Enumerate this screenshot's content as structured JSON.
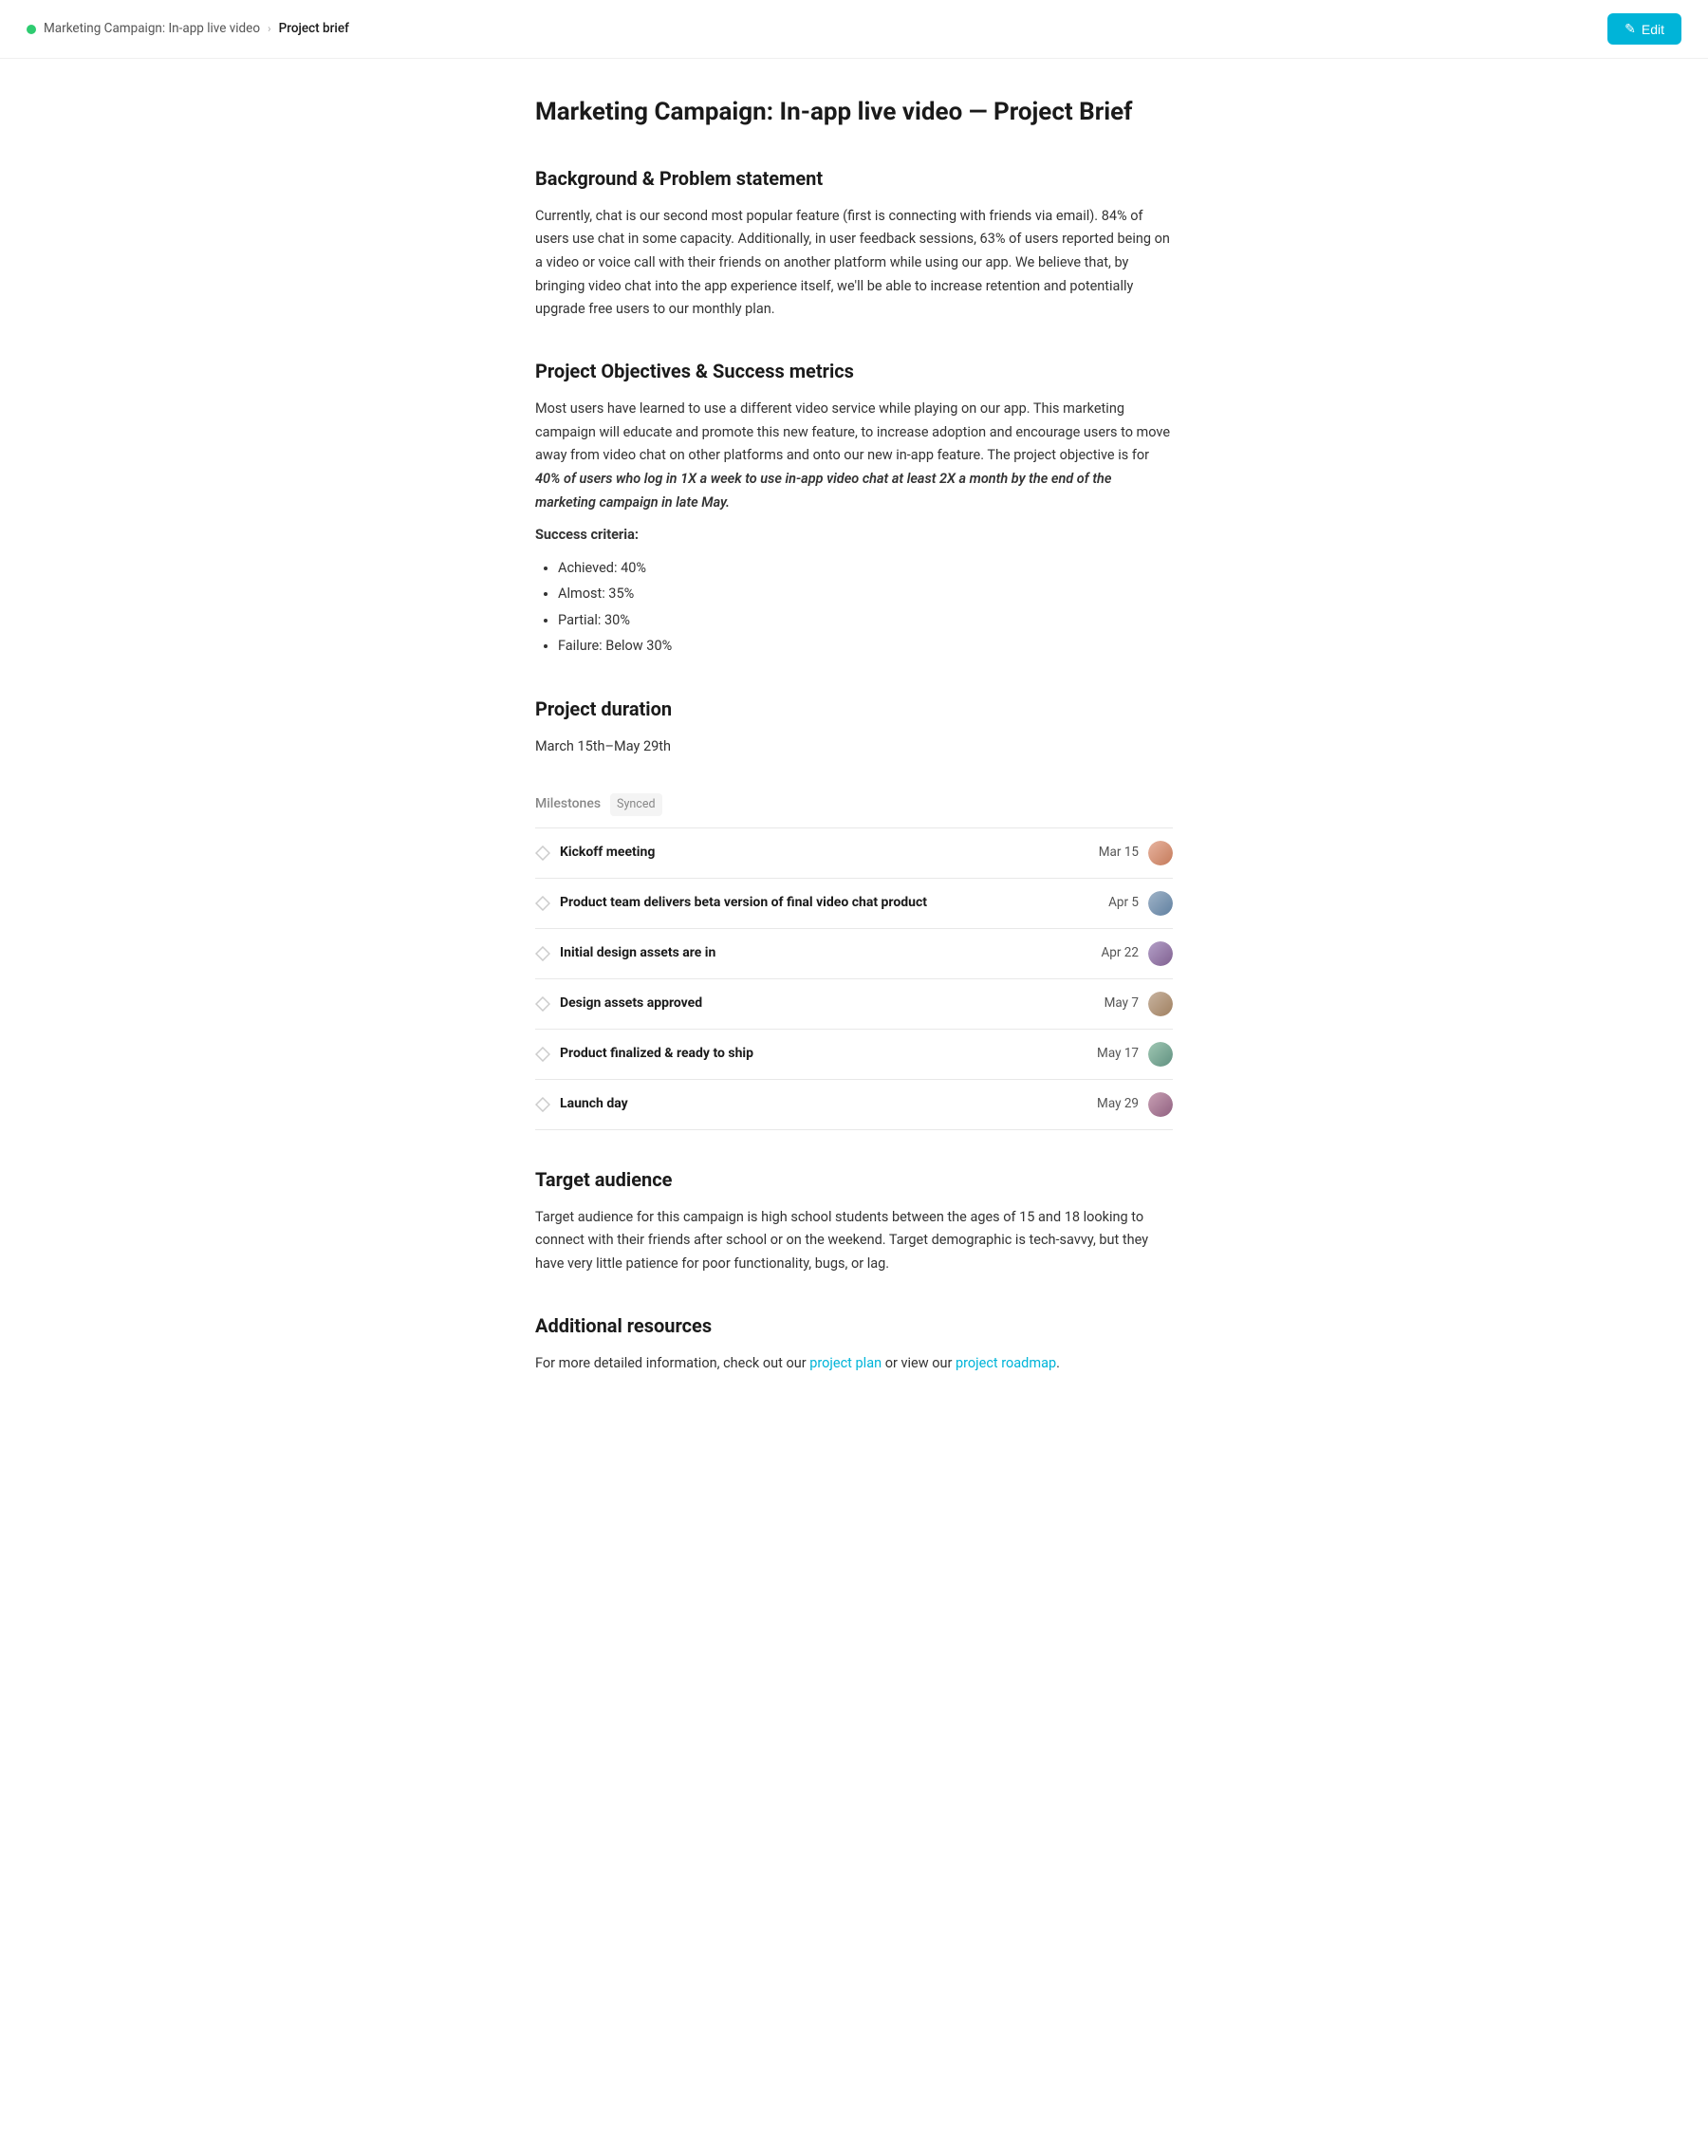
{
  "nav": {
    "dot_color": "#2ecc71",
    "parent_label": "Marketing Campaign: In-app live video",
    "chevron": "›",
    "current_label": "Project brief",
    "edit_button_label": "Edit",
    "edit_icon": "✎"
  },
  "page": {
    "title": "Marketing Campaign: In-app live video — Project Brief"
  },
  "sections": {
    "background": {
      "heading": "Background & Problem statement",
      "body": "Currently, chat is our second most popular feature (first is connecting with friends via email). 84% of users use chat in some capacity. Additionally, in user feedback sessions, 63% of users reported being on a video or voice call with their friends on another platform while using our app. We believe that, by bringing video chat into the app experience itself, we'll be able to increase retention and potentially upgrade free users to our monthly plan."
    },
    "objectives": {
      "heading": "Project Objectives & Success metrics",
      "body_prefix": "Most users have learned to use a different video service while playing on our app. This marketing campaign will educate and promote this new feature, to increase adoption and encourage users to move away from video chat on other platforms and onto our new in-app feature. The project objective is for ",
      "body_italic": "40% of users who log in 1X a week to use in-app video chat at least 2X a month by the end of the marketing campaign in late May.",
      "success_criteria_label": "Success criteria:",
      "criteria": [
        "Achieved: 40%",
        "Almost: 35%",
        "Partial: 30%",
        "Failure: Below 30%"
      ]
    },
    "duration": {
      "heading": "Project duration",
      "body": "March 15th–May 29th"
    },
    "milestones": {
      "label": "Milestones",
      "synced": "Synced",
      "items": [
        {
          "name": "Kickoff meeting",
          "date": "Mar 15",
          "avatar_class": "av1"
        },
        {
          "name": "Product team delivers beta version of final video chat product",
          "date": "Apr 5",
          "avatar_class": "av2"
        },
        {
          "name": "Initial design assets are in",
          "date": "Apr 22",
          "avatar_class": "av3"
        },
        {
          "name": "Design assets approved",
          "date": "May 7",
          "avatar_class": "av4"
        },
        {
          "name": "Product finalized & ready to ship",
          "date": "May 17",
          "avatar_class": "av5"
        },
        {
          "name": "Launch day",
          "date": "May 29",
          "avatar_class": "av6"
        }
      ]
    },
    "target_audience": {
      "heading": "Target audience",
      "body": "Target audience for this campaign is high school students between the ages of 15 and 18 looking to connect with their friends after school or on the weekend. Target demographic is tech-savvy, but they have very little patience for poor functionality, bugs, or lag."
    },
    "additional_resources": {
      "heading": "Additional resources",
      "body_prefix": "For more detailed information, check out our ",
      "link1_label": "project plan",
      "link1_href": "#",
      "body_middle": " or view our ",
      "link2_label": "project roadmap",
      "link2_href": "#",
      "body_suffix": "."
    }
  }
}
